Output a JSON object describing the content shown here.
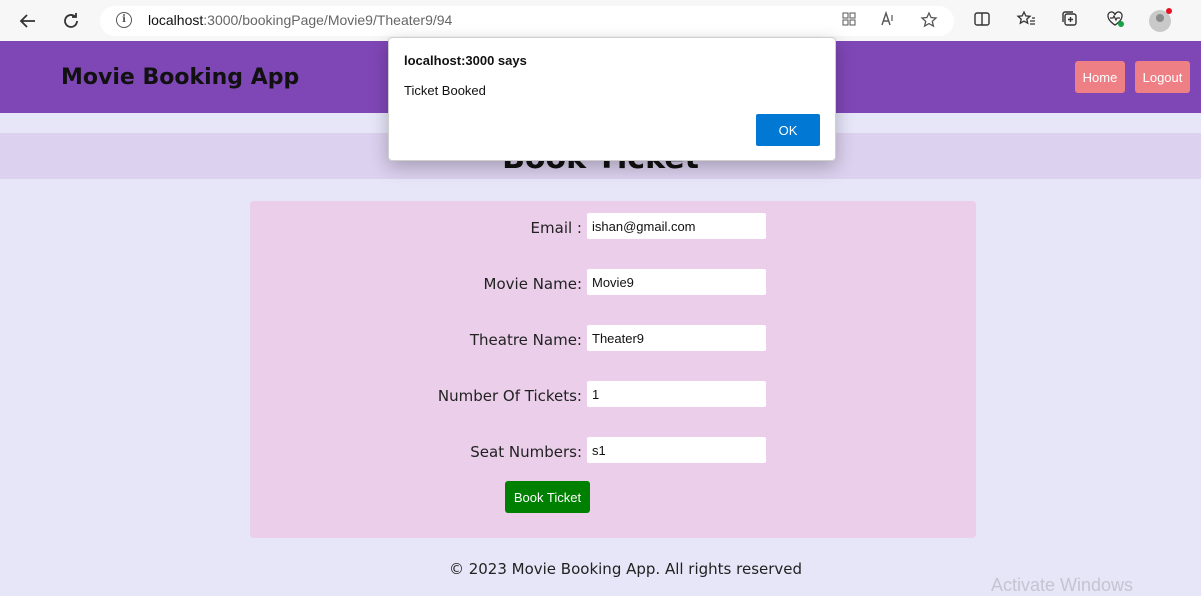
{
  "browser": {
    "url_host": "localhost",
    "url_rest": ":3000/bookingPage/Movie9/Theater9/94"
  },
  "app": {
    "brand": "Movie Booking App",
    "nav": {
      "home_label": "Home",
      "logout_label": "Logout"
    }
  },
  "page": {
    "title": "Book Ticket"
  },
  "form": {
    "email_label": "Email :",
    "email_value": "ishan@gmail.com",
    "movie_label": "Movie Name:",
    "movie_value": "Movie9",
    "theatre_label": "Theatre Name:",
    "theatre_value": "Theater9",
    "tickets_label": "Number Of Tickets:",
    "tickets_value": "1",
    "seats_label": "Seat Numbers:",
    "seats_value": "s1",
    "submit_label": "Book Ticket"
  },
  "footer": {
    "text": "© 2023 Movie Booking App. All rights reserved"
  },
  "overlay": {
    "watermark": "Activate Windows"
  },
  "dialog": {
    "title": "localhost:3000 says",
    "message": "Ticket Booked",
    "ok_label": "OK"
  },
  "colors": {
    "header_bg": "#7f47b6",
    "nav_button": "#ee7f85",
    "submit_button": "#008000",
    "dialog_ok": "#0078d4"
  }
}
